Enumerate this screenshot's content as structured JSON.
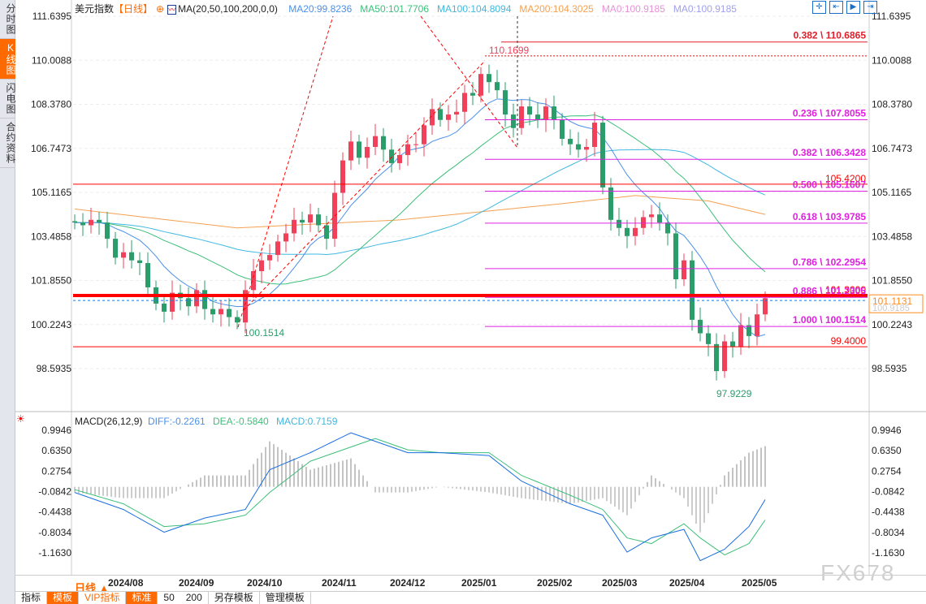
{
  "sidebar": {
    "items": [
      {
        "label": "分时图",
        "active": false
      },
      {
        "label": "K线图",
        "active": true
      },
      {
        "label": "闪电图",
        "active": false
      },
      {
        "label": "合约资料",
        "active": false
      }
    ]
  },
  "header": {
    "title": "美元指数",
    "period": "【日线】",
    "ma_label": "MA(20,50,100,200,0,0)",
    "ma": [
      {
        "text": "MA20:99.8236",
        "color": "#4a90e8"
      },
      {
        "text": "MA50:101.7706",
        "color": "#3cbf7a"
      },
      {
        "text": "MA100:104.8094",
        "color": "#40b8e0"
      },
      {
        "text": "MA200:104.3025",
        "color": "#f5a050"
      },
      {
        "text": "MA0:100.9185",
        "color": "#e890d8"
      },
      {
        "text": "MA0:100.9185",
        "color": "#a0a0f0"
      }
    ],
    "tools": [
      "crosshair-icon",
      "zoom-range-icon",
      "play-step-icon",
      "goto-end-icon"
    ]
  },
  "chart_data": {
    "type": "candlestick",
    "ylim": [
      98.5935,
      111.6395
    ],
    "y_ticks": [
      "111.6395",
      "110.0088",
      "108.3780",
      "106.7473",
      "105.1165",
      "103.4858",
      "101.8550",
      "100.2243",
      "98.5935"
    ],
    "closes": [
      104.0,
      103.9,
      104.1,
      104.0,
      103.4,
      102.7,
      102.9,
      102.6,
      102.5,
      101.6,
      101.0,
      100.7,
      101.4,
      101.2,
      100.9,
      101.5,
      100.8,
      100.6,
      100.8,
      100.5,
      100.3,
      101.5,
      102.2,
      102.6,
      102.8,
      103.3,
      103.6,
      104.1,
      104.0,
      104.3,
      103.9,
      103.4,
      105.1,
      106.3,
      107.0,
      106.4,
      106.8,
      107.2,
      106.7,
      106.2,
      106.5,
      106.9,
      106.9,
      107.6,
      108.2,
      107.8,
      108.0,
      108.1,
      108.8,
      108.7,
      109.5,
      109.2,
      108.9,
      108.0,
      107.5,
      108.3,
      108.0,
      107.8,
      108.3,
      107.8,
      107.1,
      106.9,
      106.7,
      106.8,
      107.7,
      105.3,
      104.1,
      103.8,
      103.5,
      103.8,
      104.2,
      104.3,
      104.0,
      103.6,
      101.9,
      102.6,
      100.4,
      99.9,
      99.5,
      98.5,
      99.6,
      99.4,
      100.2,
      99.8,
      100.6,
      101.2
    ],
    "x_ticks": [
      {
        "label": "2024/08",
        "index": 6.3
      },
      {
        "label": "2024/09",
        "index": 15
      },
      {
        "label": "2024/10",
        "index": 23.4
      },
      {
        "label": "2024/11",
        "index": 32.6
      },
      {
        "label": "2024/12",
        "index": 41
      },
      {
        "label": "2025/01",
        "index": 49.8
      },
      {
        "label": "2025/02",
        "index": 59.1
      },
      {
        "label": "2025/03",
        "index": 67.1
      },
      {
        "label": "2025/04",
        "index": 75.4
      },
      {
        "label": "2025/05",
        "index": 84.3
      }
    ],
    "ma200": [
      [
        0,
        104.5
      ],
      [
        20,
        103.8
      ],
      [
        40,
        104.1
      ],
      [
        60,
        104.7
      ],
      [
        69,
        105.0
      ],
      [
        78,
        104.8
      ],
      [
        85,
        104.3
      ]
    ],
    "annotations": {
      "high": "110.1699",
      "low1": "100.1514",
      "low2": "97.9229"
    },
    "fib": [
      {
        "label": "0.382 \\ 110.6865",
        "value": 110.6865,
        "color": "#e0202a"
      },
      {
        "label": "0.236 \\ 107.8055",
        "value": 107.8055,
        "color": "#e020e0"
      },
      {
        "label": "0.382 \\ 106.3428",
        "value": 106.3428,
        "color": "#e020e0"
      },
      {
        "label": "0.500 \\ 105.1607",
        "value": 105.1607,
        "color": "#e020e0"
      },
      {
        "label": "0.618 \\ 103.9785",
        "value": 103.9785,
        "color": "#e020e0"
      },
      {
        "label": "0.786 \\ 102.2954",
        "value": 102.2954,
        "color": "#e020e0"
      },
      {
        "label": "0.886 \\ 101.2305",
        "value": 101.2305,
        "color": "#e020e0"
      },
      {
        "label": "1.000 \\ 100.1514",
        "value": 100.1514,
        "color": "#e020e0"
      }
    ],
    "hlines": [
      {
        "label": "105.4200",
        "value": 105.42
      },
      {
        "label": "101.3000",
        "value": 101.3,
        "thick": true
      },
      {
        "label": "99.4000",
        "value": 99.4
      }
    ],
    "current": {
      "label": "101.1131",
      "value": 101.1131,
      "behind": "100.9185"
    },
    "colors": {
      "up": "#f0405a",
      "down": "#2a9d6a"
    },
    "macd": {
      "title": "MACD(26,12,9)",
      "diff_label": "DIFF:-0.2261",
      "dea_label": "DEA:-0.5840",
      "macd_label": "MACD:0.7159",
      "ylim": [
        -1.163,
        0.9946
      ],
      "y_ticks": [
        "0.9946",
        "0.6350",
        "0.2754",
        "-0.0842",
        "-0.4438",
        "-0.8034",
        "-1.1630"
      ],
      "diff": [
        [
          0,
          -0.1
        ],
        [
          6,
          -0.4
        ],
        [
          11,
          -0.8
        ],
        [
          16,
          -0.55
        ],
        [
          21,
          -0.4
        ],
        [
          24,
          0.3
        ],
        [
          29,
          0.6
        ],
        [
          34,
          0.95
        ],
        [
          37,
          0.8
        ],
        [
          41,
          0.6
        ],
        [
          45,
          0.6
        ],
        [
          51,
          0.55
        ],
        [
          55,
          0.1
        ],
        [
          61,
          -0.3
        ],
        [
          65,
          -0.5
        ],
        [
          68,
          -1.15
        ],
        [
          71,
          -0.9
        ],
        [
          75,
          -0.75
        ],
        [
          77,
          -1.3
        ],
        [
          80,
          -1.1
        ],
        [
          83,
          -0.7
        ],
        [
          85,
          -0.2261
        ]
      ],
      "dea": [
        [
          0,
          -0.05
        ],
        [
          6,
          -0.3
        ],
        [
          11,
          -0.7
        ],
        [
          16,
          -0.65
        ],
        [
          21,
          -0.5
        ],
        [
          24,
          -0.1
        ],
        [
          29,
          0.45
        ],
        [
          34,
          0.7
        ],
        [
          37,
          0.85
        ],
        [
          41,
          0.65
        ],
        [
          45,
          0.6
        ],
        [
          51,
          0.6
        ],
        [
          55,
          0.2
        ],
        [
          61,
          -0.15
        ],
        [
          65,
          -0.4
        ],
        [
          68,
          -0.9
        ],
        [
          71,
          -1.0
        ],
        [
          75,
          -0.65
        ],
        [
          77,
          -0.9
        ],
        [
          80,
          -1.2
        ],
        [
          83,
          -1.0
        ],
        [
          85,
          -0.584
        ]
      ]
    }
  },
  "footer": {
    "period_label": "日线 ▲",
    "toolbar": [
      "指标",
      "模板",
      "VIP指标",
      "标准",
      "50",
      "200",
      "另存模板",
      "管理模板"
    ],
    "watermark": "FX678"
  }
}
